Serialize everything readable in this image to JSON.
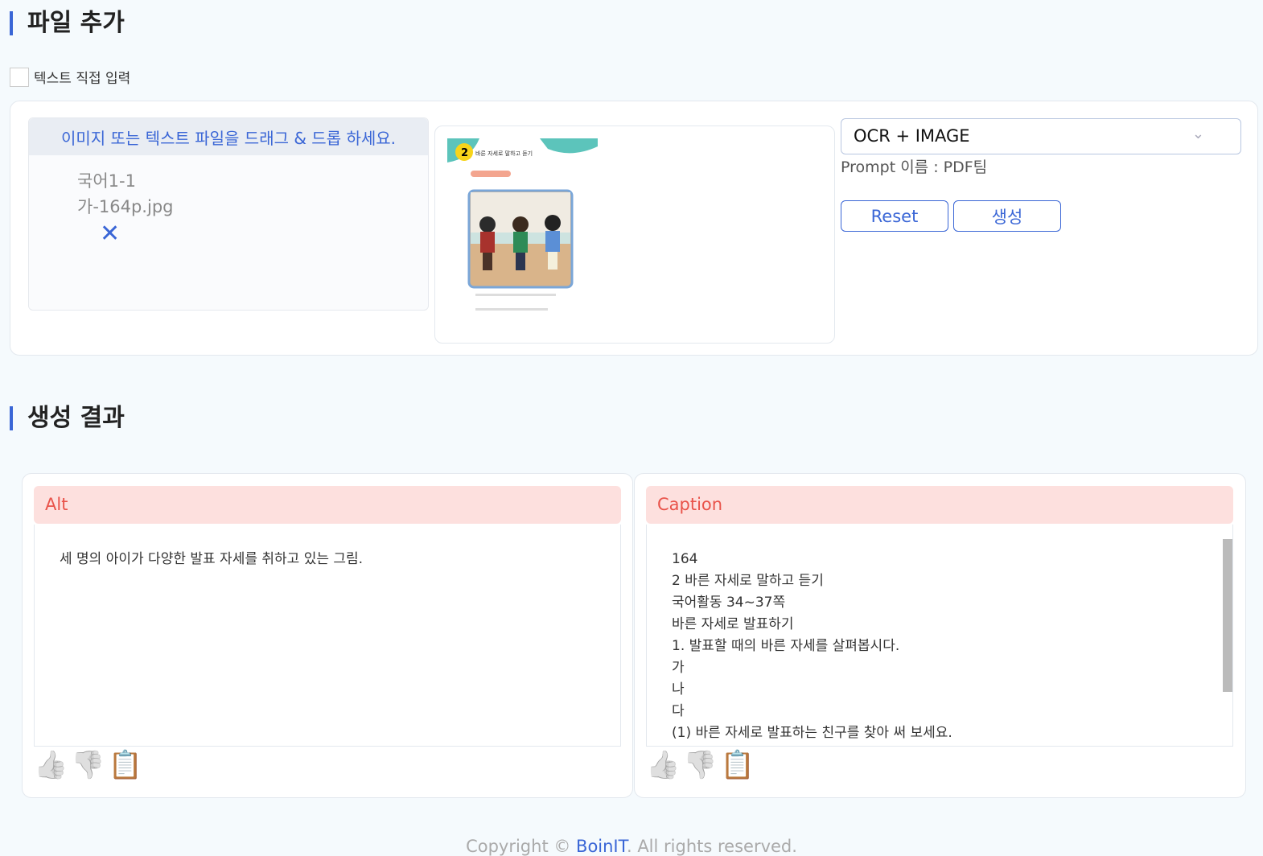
{
  "upload": {
    "title": "파일 추가",
    "direct_input_label": "텍스트 직접 입력",
    "drop_hint": "이미지 또는 텍스트 파일을 드래그 & 드롭 하세요.",
    "file_name_line1": "국어1-1",
    "file_name_line2": "가-164p.jpg",
    "preview_title": "바른 자세로 말하고 듣기",
    "mode_select": "OCR + IMAGE",
    "prompt_label": "Prompt 이름 : PDF팀",
    "reset_label": "Reset",
    "generate_label": "생성"
  },
  "results": {
    "title": "생성 결과",
    "alt": {
      "label": "Alt",
      "text": "세 명의 아이가 다양한 발표 자세를 취하고 있는 그림."
    },
    "caption": {
      "label": "Caption",
      "lines": [
        "164",
        "2 바른 자세로 말하고 듣기",
        "국어활동 34~37쪽",
        "바른 자세로 발표하기",
        "1. 발표할 때의 바른 자세를 살펴봅시다.",
        "가",
        "나",
        "다",
        "(1) 바른 자세로 발표하는 친구를 찾아 써 보세요."
      ]
    }
  },
  "footer": {
    "prefix": "Copyright © ",
    "brand": "BoinIT",
    "suffix": ". All rights reserved."
  }
}
